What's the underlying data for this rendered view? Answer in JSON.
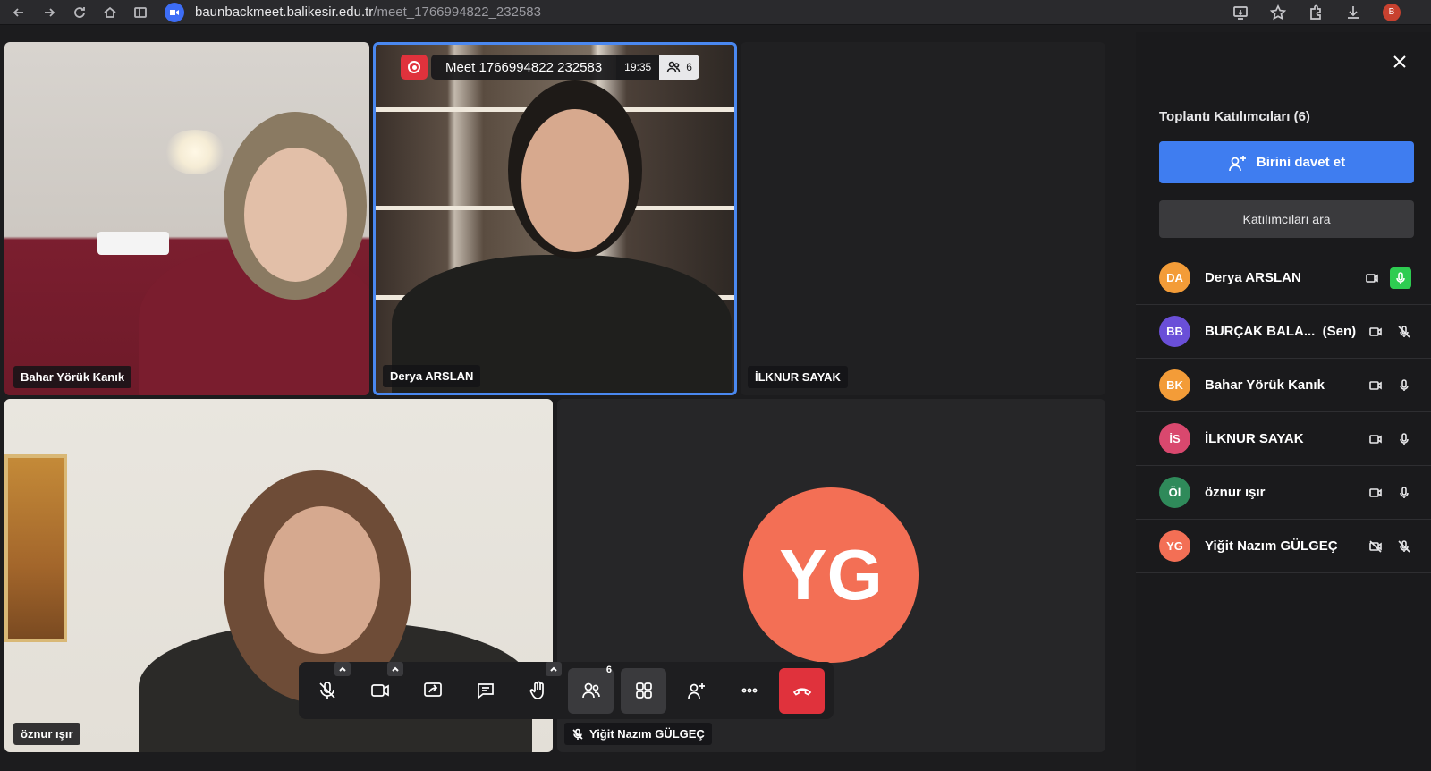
{
  "browser": {
    "url_host": "baunbackmeet.balikesir.edu.tr",
    "url_path": "/meet_1766994822_232583",
    "profile_initial": "B"
  },
  "meeting": {
    "title": "Meet 1766994822 232583",
    "time": "19:35",
    "participant_count": "6"
  },
  "tiles": [
    {
      "name": "Bahar Yörük Kanık"
    },
    {
      "name": "Derya ARSLAN"
    },
    {
      "name": "İLKNUR SAYAK"
    },
    {
      "name": "öznur ışır"
    },
    {
      "name": "Yiğit Nazım GÜLGEÇ",
      "initials": "YG"
    }
  ],
  "toolbar": {
    "participants_badge": "6"
  },
  "sidebar": {
    "title": "Toplantı Katılımcıları (6)",
    "invite_label": "Birini davet et",
    "search_label": "Katılımcıları ara",
    "participants": [
      {
        "initials": "DA",
        "name": "Derya ARSLAN",
        "color": "#f39c38"
      },
      {
        "initials": "BB",
        "name": "BURÇAK BALA...  (Sen)",
        "color": "#6a4fd8"
      },
      {
        "initials": "BK",
        "name": "Bahar Yörük Kanık",
        "color": "#f39c38"
      },
      {
        "initials": "İS",
        "name": "İLKNUR SAYAK",
        "color": "#d9486e"
      },
      {
        "initials": "Öİ",
        "name": "öznur ışır",
        "color": "#2f8a5a"
      },
      {
        "initials": "YG",
        "name": "Yiğit Nazım GÜLGEÇ",
        "color": "#f36f55"
      }
    ]
  },
  "colors": {
    "accent": "#3f7df0",
    "leave": "#e0323c",
    "active_speaker": "#2ecc51"
  }
}
